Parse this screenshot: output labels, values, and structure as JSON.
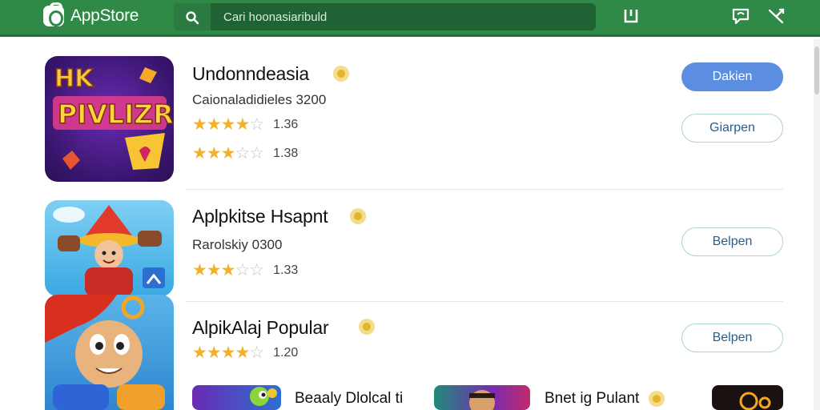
{
  "header": {
    "brand": "AppStore",
    "search_placeholder": "Cari hoonasiaribuld",
    "icons": [
      "app-store-logo-icon",
      "search-icon",
      "bag-icon",
      "chat-icon",
      "share-icon"
    ]
  },
  "apps": [
    {
      "title": "Undonndeasia",
      "subtitle": "Caionaladidieles 3200",
      "ratings": [
        {
          "stars": 4.5,
          "value": "1.36"
        },
        {
          "stars": 3.5,
          "value": "1.38"
        }
      ],
      "primary_label": "Dakien",
      "secondary_label": "Giarpen",
      "icon_art_text": "PIVLIZR",
      "icon_art_text_top": "HK"
    },
    {
      "title": "Aplpkitse Hsapnt",
      "subtitle": "Rarolskiy 0300",
      "ratings": [
        {
          "stars": 3.5,
          "value": "1.33"
        }
      ],
      "secondary_label": "Belpen"
    },
    {
      "title": "AlpikAlaj Popular",
      "ratings": [
        {
          "stars": 4.5,
          "value": "1.20"
        }
      ],
      "secondary_label": "Belpen"
    }
  ],
  "bottom_strip": [
    {
      "title": "Beaaly Dlolcal ti"
    },
    {
      "title": "Bnet ig Pulant"
    }
  ],
  "colors": {
    "header_green": "#2f8a47",
    "primary_button": "#5b8ee0",
    "star": "#f1b12c"
  }
}
